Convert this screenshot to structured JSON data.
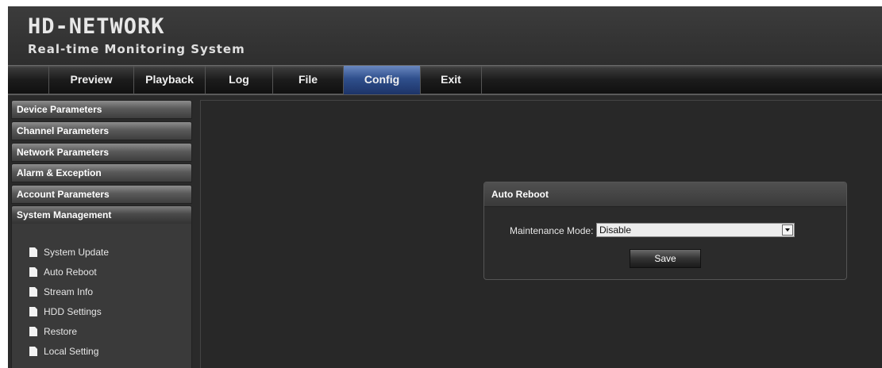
{
  "header": {
    "title": "HD-NETWORK",
    "subtitle": "Real-time Monitoring System"
  },
  "nav": {
    "tabs": [
      {
        "label": "Preview"
      },
      {
        "label": "Playback"
      },
      {
        "label": "Log"
      },
      {
        "label": "File"
      },
      {
        "label": "Config",
        "active": true
      },
      {
        "label": "Exit"
      }
    ]
  },
  "sidebar": {
    "sections": [
      {
        "label": "Device Parameters"
      },
      {
        "label": "Channel Parameters"
      },
      {
        "label": "Network Parameters"
      },
      {
        "label": "Alarm & Exception"
      },
      {
        "label": "Account Parameters"
      },
      {
        "label": "System Management",
        "expanded": true
      }
    ],
    "sub_items": [
      {
        "label": "System Update",
        "icon": "document-icon"
      },
      {
        "label": "Auto Reboot",
        "icon": "document-icon"
      },
      {
        "label": "Stream Info",
        "icon": "document-icon"
      },
      {
        "label": "HDD Settings",
        "icon": "document-icon"
      },
      {
        "label": "Restore",
        "icon": "document-icon"
      },
      {
        "label": "Local Setting",
        "icon": "document-icon"
      }
    ]
  },
  "panel": {
    "title": "Auto Reboot",
    "maintenance_label": "Maintenance Mode:",
    "maintenance_value": "Disable",
    "save_label": "Save"
  },
  "colors": {
    "active_tab": "#2f4f8c",
    "background": "#2a2a2a"
  }
}
